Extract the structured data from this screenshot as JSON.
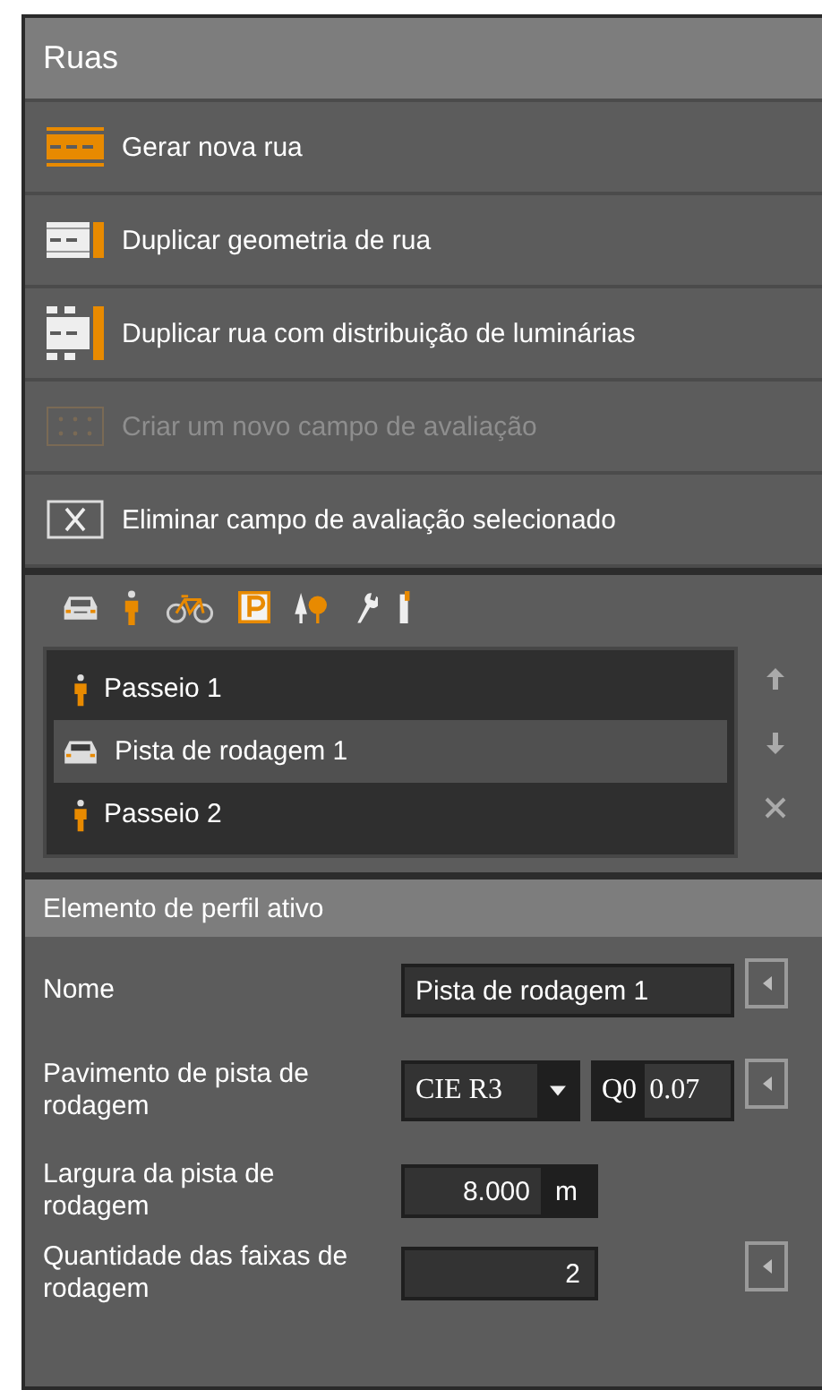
{
  "panel": {
    "title": "Ruas"
  },
  "actions": [
    {
      "label": "Gerar nova rua",
      "kind": "new-road",
      "disabled": false
    },
    {
      "label": "Duplicar geometria de rua",
      "kind": "duplicate-geometry",
      "disabled": false
    },
    {
      "label": "Duplicar rua com distribuição de luminárias",
      "kind": "duplicate-luminaires",
      "disabled": false
    },
    {
      "label": "Criar um novo campo de avaliação",
      "kind": "new-field",
      "disabled": true
    },
    {
      "label": "Eliminar campo de avaliação selecionado",
      "kind": "delete-field",
      "disabled": false
    }
  ],
  "elements": [
    {
      "label": "Passeio 1",
      "kind": "sidewalk",
      "selected": false
    },
    {
      "label": "Pista de rodagem 1",
      "kind": "roadway",
      "selected": true
    },
    {
      "label": "Passeio 2",
      "kind": "sidewalk",
      "selected": false
    }
  ],
  "properties_title": "Elemento de perfil ativo",
  "properties": [
    {
      "label": "Nome",
      "kind": "text",
      "value": "Pista de rodagem 1",
      "reset": true
    },
    {
      "label": "Pavimento de pista de rodagem",
      "kind": "surface",
      "value": "CIE R3",
      "q_label": "Q0",
      "q_value": "0.07",
      "reset": true
    },
    {
      "label": "Largura da pista de rodagem",
      "kind": "length",
      "value": "8.000",
      "unit": "m",
      "reset": false
    },
    {
      "label": "Quantidade das faixas de rodagem",
      "kind": "count",
      "value": "2",
      "reset": true
    }
  ]
}
